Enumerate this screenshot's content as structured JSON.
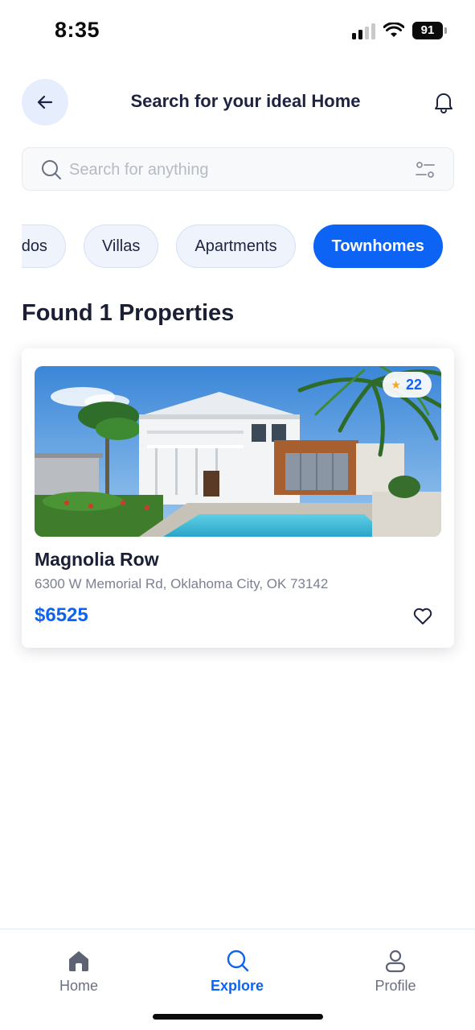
{
  "status_bar": {
    "time": "8:35",
    "battery": "91",
    "icons": [
      "cellular-signal-icon",
      "wifi-icon",
      "battery-icon"
    ]
  },
  "header": {
    "title": "Search for your ideal Home",
    "back_icon": "arrow-left-icon",
    "notification_icon": "bell-icon"
  },
  "search": {
    "placeholder": "Search for anything",
    "value": "",
    "icon": "search-icon",
    "filter_icon": "sliders-icon"
  },
  "categories": {
    "items": [
      {
        "label": "Condos",
        "active": false
      },
      {
        "label": "Villas",
        "active": false
      },
      {
        "label": "Apartments",
        "active": false
      },
      {
        "label": "Townhomes",
        "active": true
      }
    ]
  },
  "results": {
    "heading": "Found 1 Properties"
  },
  "property": {
    "name": "Magnolia Row",
    "address": "6300 W Memorial Rd, Oklahoma City, OK 73142",
    "price": "$6525",
    "rating": "22",
    "rating_icon": "star-icon",
    "favorite_icon": "heart-icon"
  },
  "bottom_nav": {
    "items": [
      {
        "label": "Home",
        "icon": "home-icon",
        "active": false
      },
      {
        "label": "Explore",
        "icon": "search-icon",
        "active": true
      },
      {
        "label": "Profile",
        "icon": "user-icon",
        "active": false
      }
    ]
  },
  "colors": {
    "accent": "#0d63f3",
    "chip_bg": "#eef3fc",
    "text_primary": "#1a1f36",
    "text_secondary": "#7c8190",
    "star": "#f5a623"
  }
}
